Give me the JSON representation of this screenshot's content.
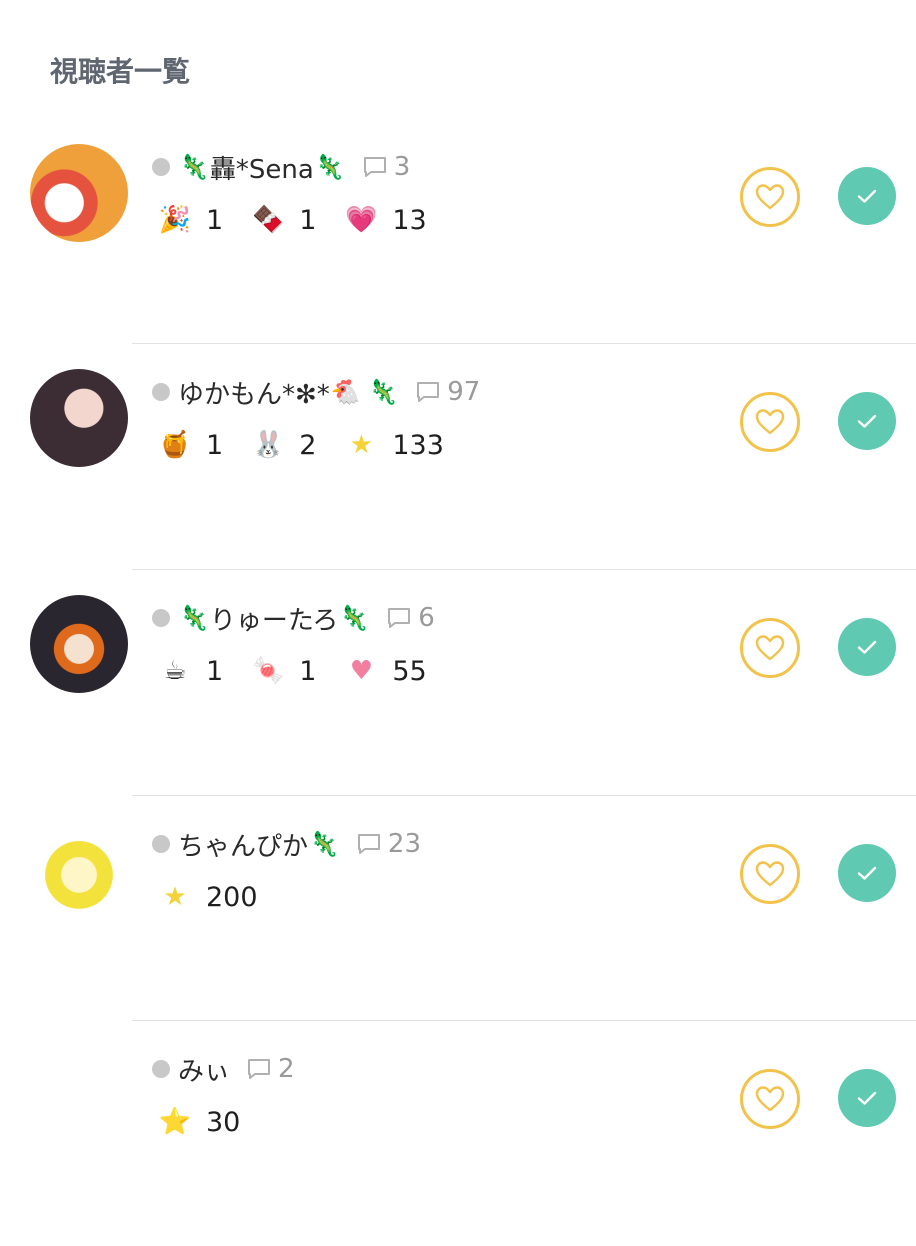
{
  "header": {
    "title": "視聴者一覧"
  },
  "viewers": [
    {
      "name": "轟*Sena",
      "name_prefix_icon": "🦎",
      "name_suffix_icon": "🦎",
      "comments": "3",
      "gifts": [
        {
          "icon": "party-popper-icon",
          "glyph": "🎉",
          "count": "1"
        },
        {
          "icon": "chocolate-icon",
          "glyph": "🍫",
          "count": "1"
        },
        {
          "icon": "heart-icon",
          "glyph": "💗",
          "count": "13"
        }
      ]
    },
    {
      "name": "ゆかもん*✻*",
      "name_prefix_icon": "",
      "name_suffix_icon": "🐔 🦎",
      "comments": "97",
      "gifts": [
        {
          "icon": "honey-jar-icon",
          "glyph": "🍯",
          "count": "1"
        },
        {
          "icon": "bunny-sticker-icon",
          "glyph": "🐰",
          "count": "2"
        },
        {
          "icon": "star-icon",
          "glyph": "★",
          "count": "133"
        }
      ]
    },
    {
      "name": "りゅーたろ",
      "name_prefix_icon": "🦎",
      "name_suffix_icon": "🦎",
      "comments": "6",
      "gifts": [
        {
          "icon": "coffee-cup-icon",
          "glyph": "☕",
          "count": "1"
        },
        {
          "icon": "candy-icon",
          "glyph": "🍬",
          "count": "1"
        },
        {
          "icon": "heart-icon",
          "glyph": "♥",
          "count": "55"
        }
      ]
    },
    {
      "name": "ちゃんぴか",
      "name_prefix_icon": "",
      "name_suffix_icon": "🦎",
      "comments": "23",
      "gifts": [
        {
          "icon": "star-icon",
          "glyph": "★",
          "count": "200"
        }
      ]
    },
    {
      "name": "みぃ",
      "name_prefix_icon": "",
      "name_suffix_icon": "",
      "comments": "2",
      "gifts": [
        {
          "icon": "star-icon",
          "glyph": "⭐",
          "count": "30"
        }
      ]
    }
  ],
  "colors": {
    "heart_outline": "#f2c24a",
    "check_fill": "#5fcab1",
    "online_dot": "#c8c8c8"
  }
}
